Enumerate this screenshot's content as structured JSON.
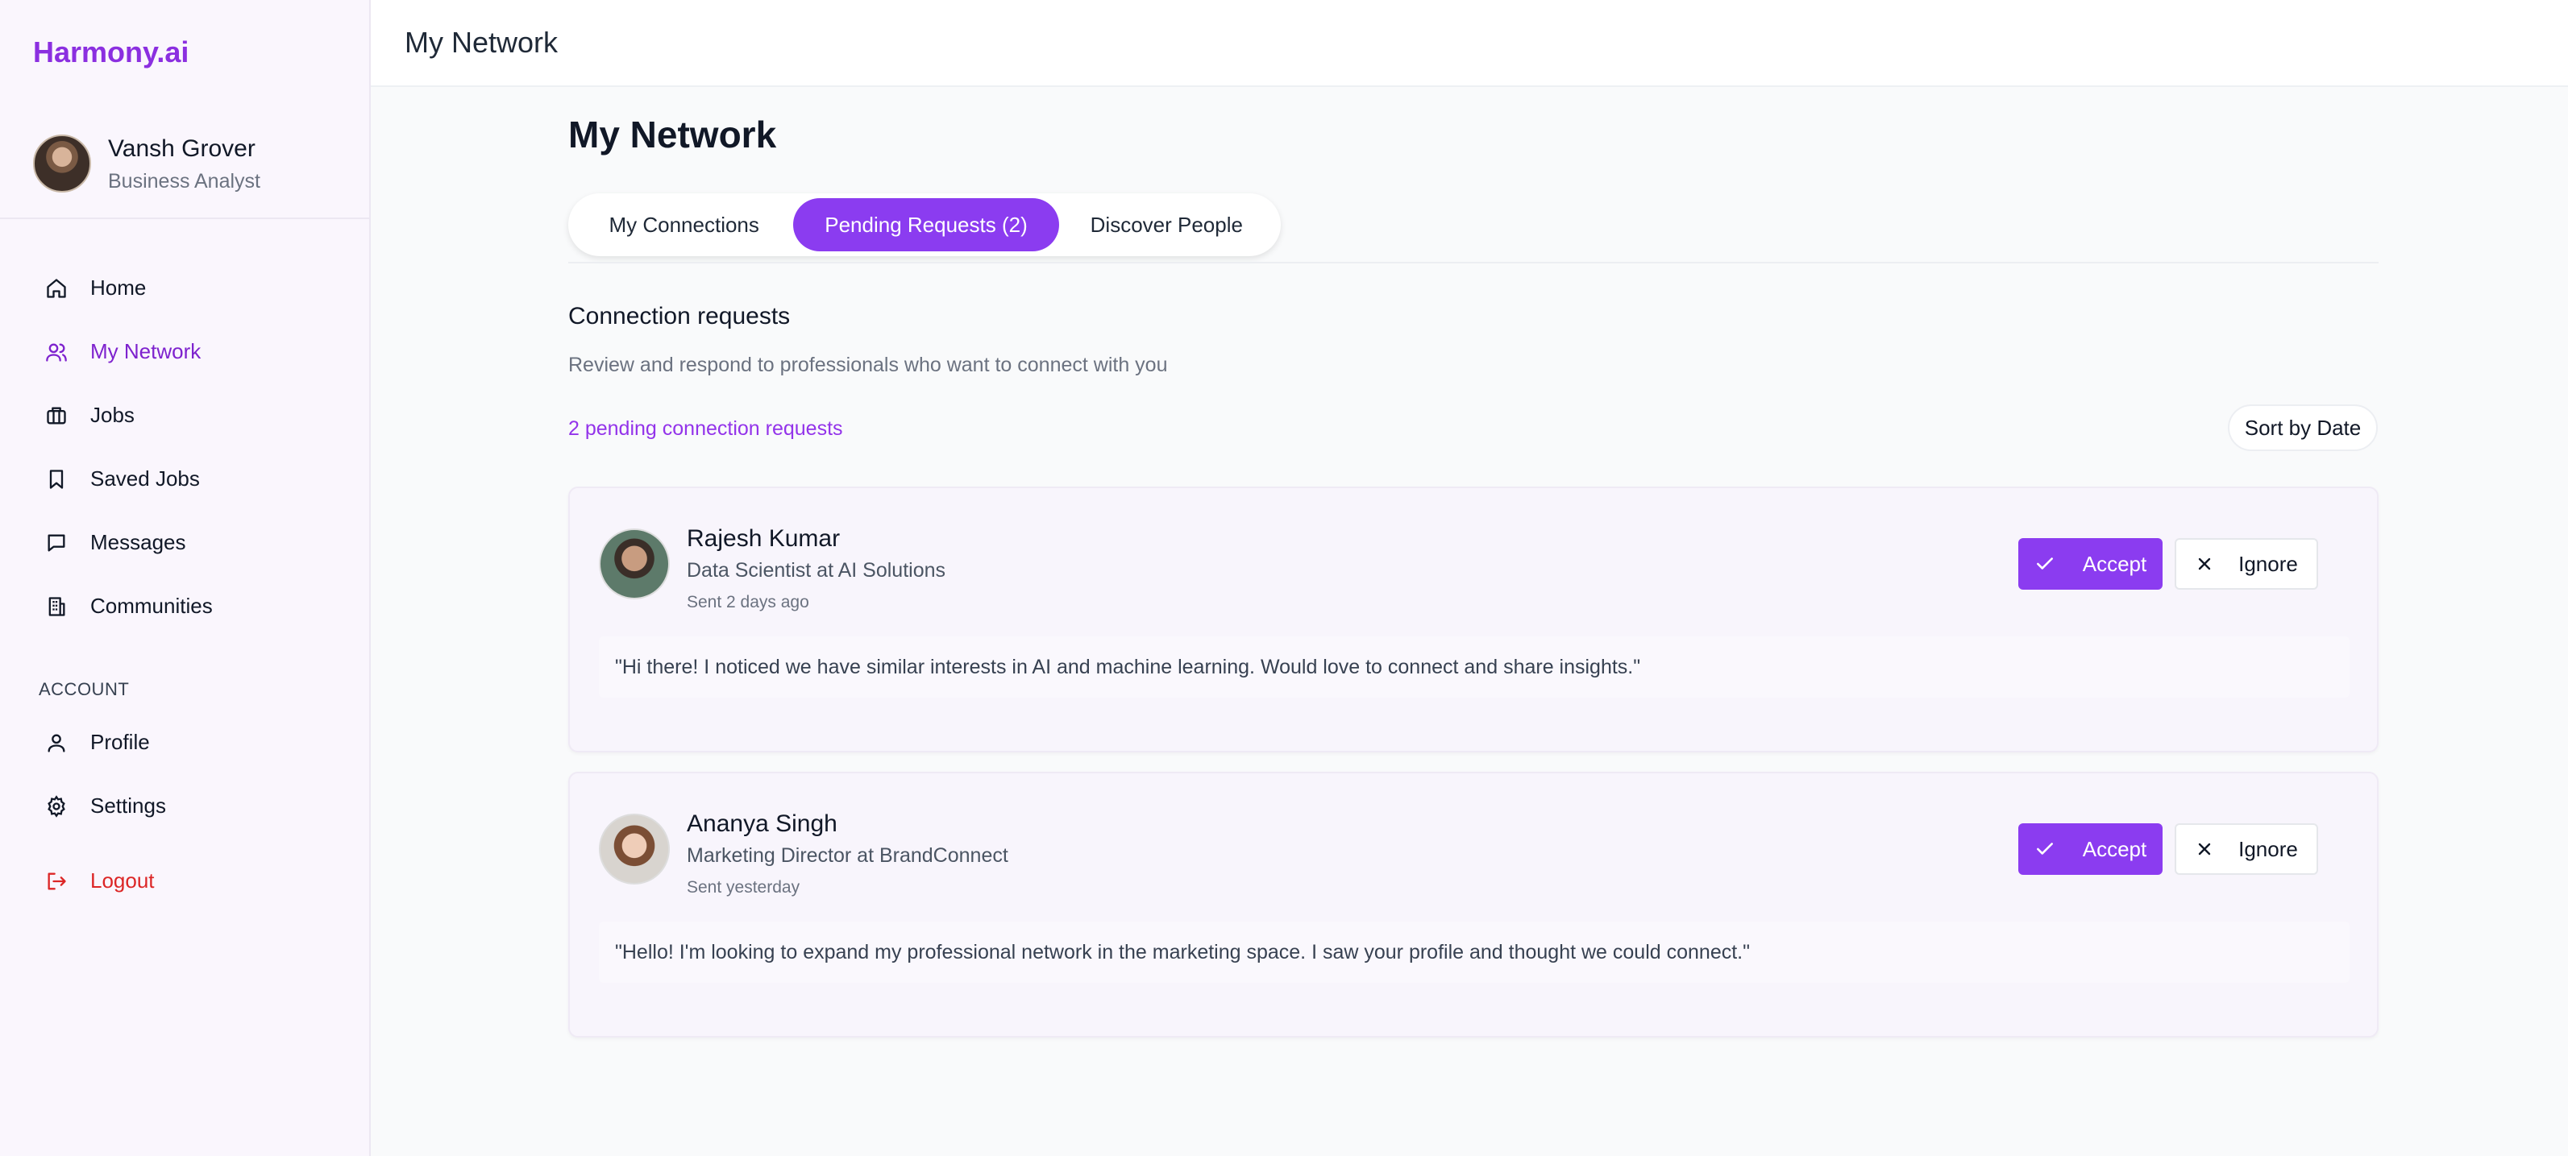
{
  "app": {
    "brand": "Harmony.ai",
    "page_title_top": "My Network",
    "accent_color": "#8b3cf0",
    "danger_color": "#dc2626"
  },
  "user": {
    "name": "Vansh Grover",
    "role": "Business Analyst"
  },
  "sidebar": {
    "items": [
      {
        "label": "Home",
        "icon": "home-icon"
      },
      {
        "label": "My Network",
        "icon": "users-icon",
        "active": true
      },
      {
        "label": "Jobs",
        "icon": "briefcase-icon"
      },
      {
        "label": "Saved Jobs",
        "icon": "bookmark-icon"
      },
      {
        "label": "Messages",
        "icon": "message-icon"
      },
      {
        "label": "Communities",
        "icon": "building-icon"
      }
    ],
    "section_label": "ACCOUNT",
    "account_items": [
      {
        "label": "Profile",
        "icon": "user-icon"
      },
      {
        "label": "Settings",
        "icon": "gear-icon"
      }
    ],
    "logout_label": "Logout"
  },
  "main": {
    "title": "My Network",
    "tabs": [
      {
        "label": "My Connections"
      },
      {
        "label": "Pending Requests (2)",
        "active": true
      },
      {
        "label": "Discover People"
      }
    ],
    "section_title": "Connection requests",
    "section_desc": "Review and respond to professionals who want to connect with you",
    "pending_count": "2 pending connection requests",
    "sort_label": "Sort by Date",
    "accept_label": "Accept",
    "ignore_label": "Ignore",
    "requests": [
      {
        "name": "Rajesh Kumar",
        "role": "Data Scientist at AI Solutions",
        "sent": "Sent 2 days ago",
        "message": "\"Hi there! I noticed we have similar interests in AI and machine learning. Would love to connect and share insights.\""
      },
      {
        "name": "Ananya Singh",
        "role": "Marketing Director at BrandConnect",
        "sent": "Sent yesterday",
        "message": "\"Hello! I'm looking to expand my professional network in the marketing space. I saw your profile and thought we could connect.\""
      }
    ]
  }
}
